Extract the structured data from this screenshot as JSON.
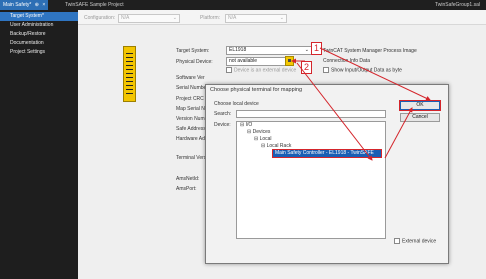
{
  "titlebar": {
    "active_tab": "Main Safety*",
    "tab_pin": "⊕",
    "tab_close": "×",
    "project_tab": "TwinSAFE Sample Project",
    "file": "TwinSafeGroup1.sal"
  },
  "sidebar": {
    "items": [
      {
        "label": "Target System*",
        "active": true
      },
      {
        "label": "User Administration"
      },
      {
        "label": "Backup/Restore"
      },
      {
        "label": "Documentation"
      },
      {
        "label": "Project Settings"
      }
    ]
  },
  "configbar": {
    "configuration_label": "Configuration:",
    "configuration_value": "N/A",
    "platform_label": "Platform:",
    "platform_value": "N/A"
  },
  "target": {
    "target_system_label": "Target System:",
    "target_system_value": "EL1918",
    "physical_device_label": "Physical Device:",
    "physical_device_value": "not available",
    "external_device_label": "Device is an external device",
    "process_image_title": "TwinCAT System Manager Process Image",
    "connection_info_label": "Connection Info Data",
    "show_io_label": "Show Input/Output Data as byte",
    "software_label": "Software Ver",
    "serial_label": "Serial Numbe",
    "project_crc_label": "Project CRC",
    "map_serial_label": "Map Serial N",
    "version_label": "Version Num",
    "safe_address_label": "Safe Address",
    "hardware_label": "Hardware Ad",
    "terminal_label": "Terminal Vers",
    "ams_netid_label": "AmsNetId:",
    "ams_port_label": "AmsPort:"
  },
  "callouts": {
    "first": "1",
    "second": "2"
  },
  "dialog": {
    "title": "Choose physical terminal for mapping",
    "choose_local_label": "Choose local device",
    "search_label": "Search:",
    "device_label": "Device:",
    "ok_label": "OK",
    "cancel_label": "Cancel",
    "external_device_label": "External device",
    "tree": [
      {
        "label": "I/O",
        "level": 0,
        "prefix": "⊟"
      },
      {
        "label": "Devices",
        "level": 1,
        "prefix": "⊟"
      },
      {
        "label": "Local",
        "level": 2,
        "prefix": "⊟"
      },
      {
        "label": "Local Rack",
        "level": 3,
        "prefix": "⊟"
      },
      {
        "label": "Main Safety Controller - EL1918 - TwinSAFE",
        "level": 4,
        "prefix": ""
      }
    ]
  },
  "colors": {
    "accent": "#2f75c2",
    "callout_red": "#d4252b",
    "highlight": "#1a5fb4"
  }
}
